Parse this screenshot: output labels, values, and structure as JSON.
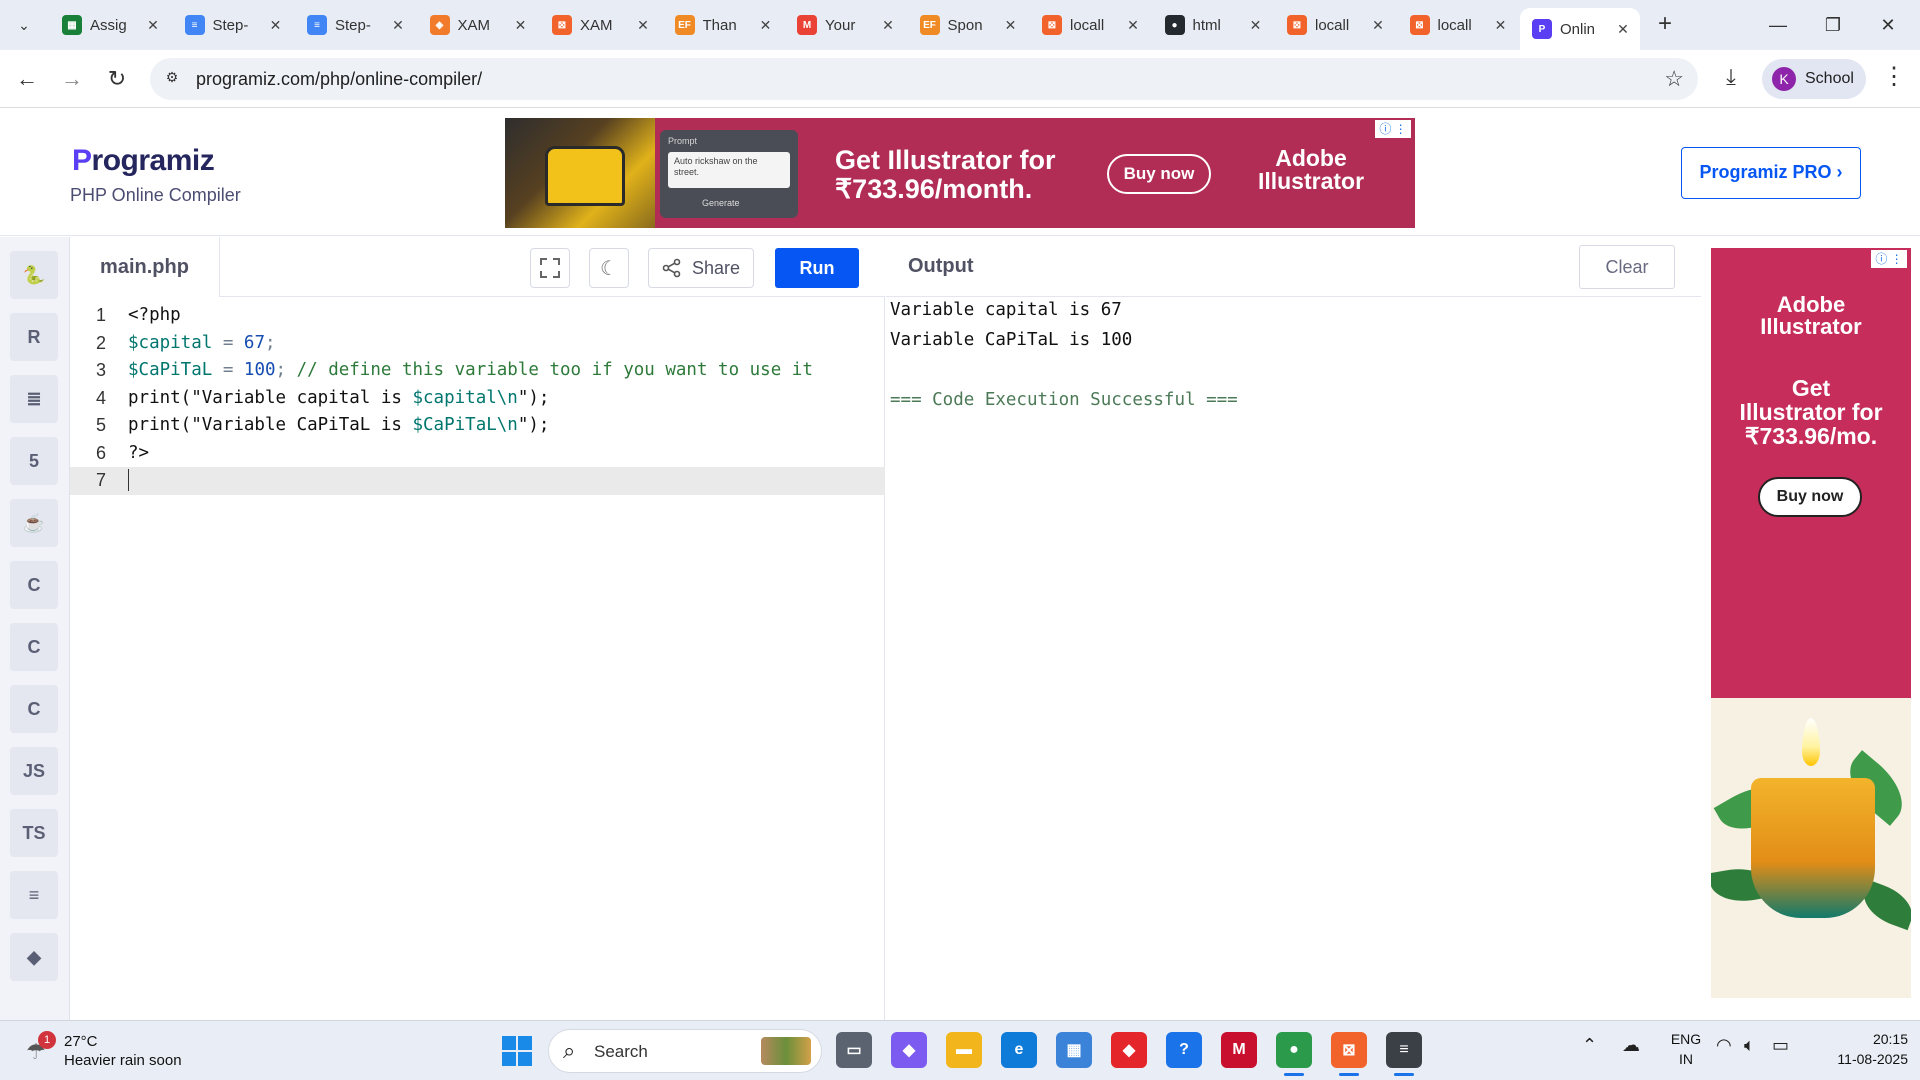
{
  "browser": {
    "tabs": [
      {
        "title": "Assig",
        "fav": "sheets",
        "color": "#188038"
      },
      {
        "title": "Step-",
        "fav": "docs",
        "color": "#4285f4"
      },
      {
        "title": "Step-",
        "fav": "docs",
        "color": "#4285f4"
      },
      {
        "title": "XAM",
        "fav": "xampp-diamond",
        "color": "#f27b2b"
      },
      {
        "title": "XAM",
        "fav": "xampp",
        "color": "#f2632b"
      },
      {
        "title": "Than",
        "fav": "ef",
        "color": "#f08a24"
      },
      {
        "title": "Your",
        "fav": "gmail",
        "color": "#ea4335"
      },
      {
        "title": "Spon",
        "fav": "ef",
        "color": "#f08a24"
      },
      {
        "title": "locall",
        "fav": "xampp",
        "color": "#f2632b"
      },
      {
        "title": "html",
        "fav": "github",
        "color": "#24292f"
      },
      {
        "title": "locall",
        "fav": "xampp",
        "color": "#f2632b"
      },
      {
        "title": "locall",
        "fav": "xampp",
        "color": "#f2632b"
      },
      {
        "title": "Onlin",
        "fav": "programiz",
        "color": "#5a3ef3",
        "active": true
      }
    ],
    "url": "programiz.com/php/online-compiler/",
    "profile_initial": "K",
    "profile_name": "School"
  },
  "header": {
    "logo": "Programiz",
    "logo_first": "P",
    "logo_rest": "rogramiz",
    "subtitle": "PHP Online Compiler",
    "pro_button": "Programiz PRO ›"
  },
  "top_ad": {
    "prompt_label": "Prompt",
    "prompt_text": "Auto rickshaw on the street.",
    "generate": "Generate",
    "headline_1": "Get Illustrator for",
    "headline_2": "₹733.96/month.",
    "buy": "Buy now",
    "brand_1": "Adobe",
    "brand_2": "Illustrator"
  },
  "rail": {
    "items": [
      {
        "name": "python",
        "glyph": "🐍"
      },
      {
        "name": "r",
        "glyph": "R"
      },
      {
        "name": "sql",
        "glyph": "≣"
      },
      {
        "name": "html",
        "glyph": "5"
      },
      {
        "name": "java",
        "glyph": "☕"
      },
      {
        "name": "c",
        "glyph": "C"
      },
      {
        "name": "cpp",
        "glyph": "C"
      },
      {
        "name": "csharp",
        "glyph": "C"
      },
      {
        "name": "javascript",
        "glyph": "JS"
      },
      {
        "name": "typescript",
        "glyph": "TS"
      },
      {
        "name": "go",
        "glyph": "≡"
      },
      {
        "name": "swift",
        "glyph": "◆"
      }
    ]
  },
  "editor": {
    "filename": "main.php",
    "share_label": "Share",
    "run_label": "Run",
    "lines": [
      {
        "n": "1",
        "tokens": [
          {
            "t": "<?php",
            "c": "kw"
          }
        ]
      },
      {
        "n": "2",
        "tokens": [
          {
            "t": "$capital",
            "c": "var"
          },
          {
            "t": " = ",
            "c": "op"
          },
          {
            "t": "67",
            "c": "num"
          },
          {
            "t": ";",
            "c": "op"
          }
        ]
      },
      {
        "n": "3",
        "tokens": [
          {
            "t": "$CaPiTaL",
            "c": "var"
          },
          {
            "t": " = ",
            "c": "op"
          },
          {
            "t": "100",
            "c": "num"
          },
          {
            "t": "; ",
            "c": "op"
          },
          {
            "t": "// define this variable too if you want to use it",
            "c": "cm"
          }
        ]
      },
      {
        "n": "4",
        "tokens": [
          {
            "t": "print(\"Variable capital is ",
            "c": "str"
          },
          {
            "t": "$capital\\n",
            "c": "var"
          },
          {
            "t": "\");",
            "c": "str"
          }
        ]
      },
      {
        "n": "5",
        "tokens": [
          {
            "t": "print(\"Variable CaPiTaL is ",
            "c": "str"
          },
          {
            "t": "$CaPiTaL\\n",
            "c": "var"
          },
          {
            "t": "\");",
            "c": "str"
          }
        ]
      },
      {
        "n": "6",
        "tokens": [
          {
            "t": "?>",
            "c": "kw"
          }
        ]
      },
      {
        "n": "7",
        "tokens": [],
        "current": true
      }
    ]
  },
  "output": {
    "title": "Output",
    "clear_label": "Clear",
    "lines": [
      {
        "text": "Variable capital is 67",
        "kind": "normal"
      },
      {
        "text": "Variable CaPiTaL is 100",
        "kind": "normal"
      },
      {
        "text": "",
        "kind": "normal"
      },
      {
        "text": "=== Code Execution Successful ===",
        "kind": "success"
      }
    ]
  },
  "side_ad": {
    "brand_1": "Adobe",
    "brand_2": "Illustrator",
    "head_1": "Get",
    "head_2": "Illustrator for",
    "head_3": "₹733.96/mo.",
    "buy": "Buy now"
  },
  "taskbar": {
    "weather_badge": "1",
    "temperature": "27°C",
    "weather_desc": "Heavier rain soon",
    "search_label": "Search",
    "lang_1": "ENG",
    "lang_2": "IN",
    "time": "20:15",
    "date": "11-08-2025",
    "apps": [
      {
        "name": "task-view",
        "color": "#5b6270",
        "glyph": "▭"
      },
      {
        "name": "copilot",
        "color": "#7c5cf0",
        "glyph": "◆"
      },
      {
        "name": "file-explorer",
        "color": "#f2b51b",
        "glyph": "▬"
      },
      {
        "name": "edge",
        "color": "#0f7bd8",
        "glyph": "e"
      },
      {
        "name": "microsoft-store",
        "color": "#3a83d8",
        "glyph": "▦"
      },
      {
        "name": "anydesk",
        "color": "#e4252a",
        "glyph": "◆"
      },
      {
        "name": "help",
        "color": "#1a73e8",
        "glyph": "?"
      },
      {
        "name": "mcafee",
        "color": "#c8102e",
        "glyph": "M"
      },
      {
        "name": "chrome",
        "color": "#2c9a4b",
        "glyph": "●",
        "active": true
      },
      {
        "name": "xampp",
        "color": "#f2632b",
        "glyph": "⊠",
        "active": true
      },
      {
        "name": "sublime",
        "color": "#3b3f46",
        "glyph": "≡",
        "active": true
      }
    ]
  }
}
